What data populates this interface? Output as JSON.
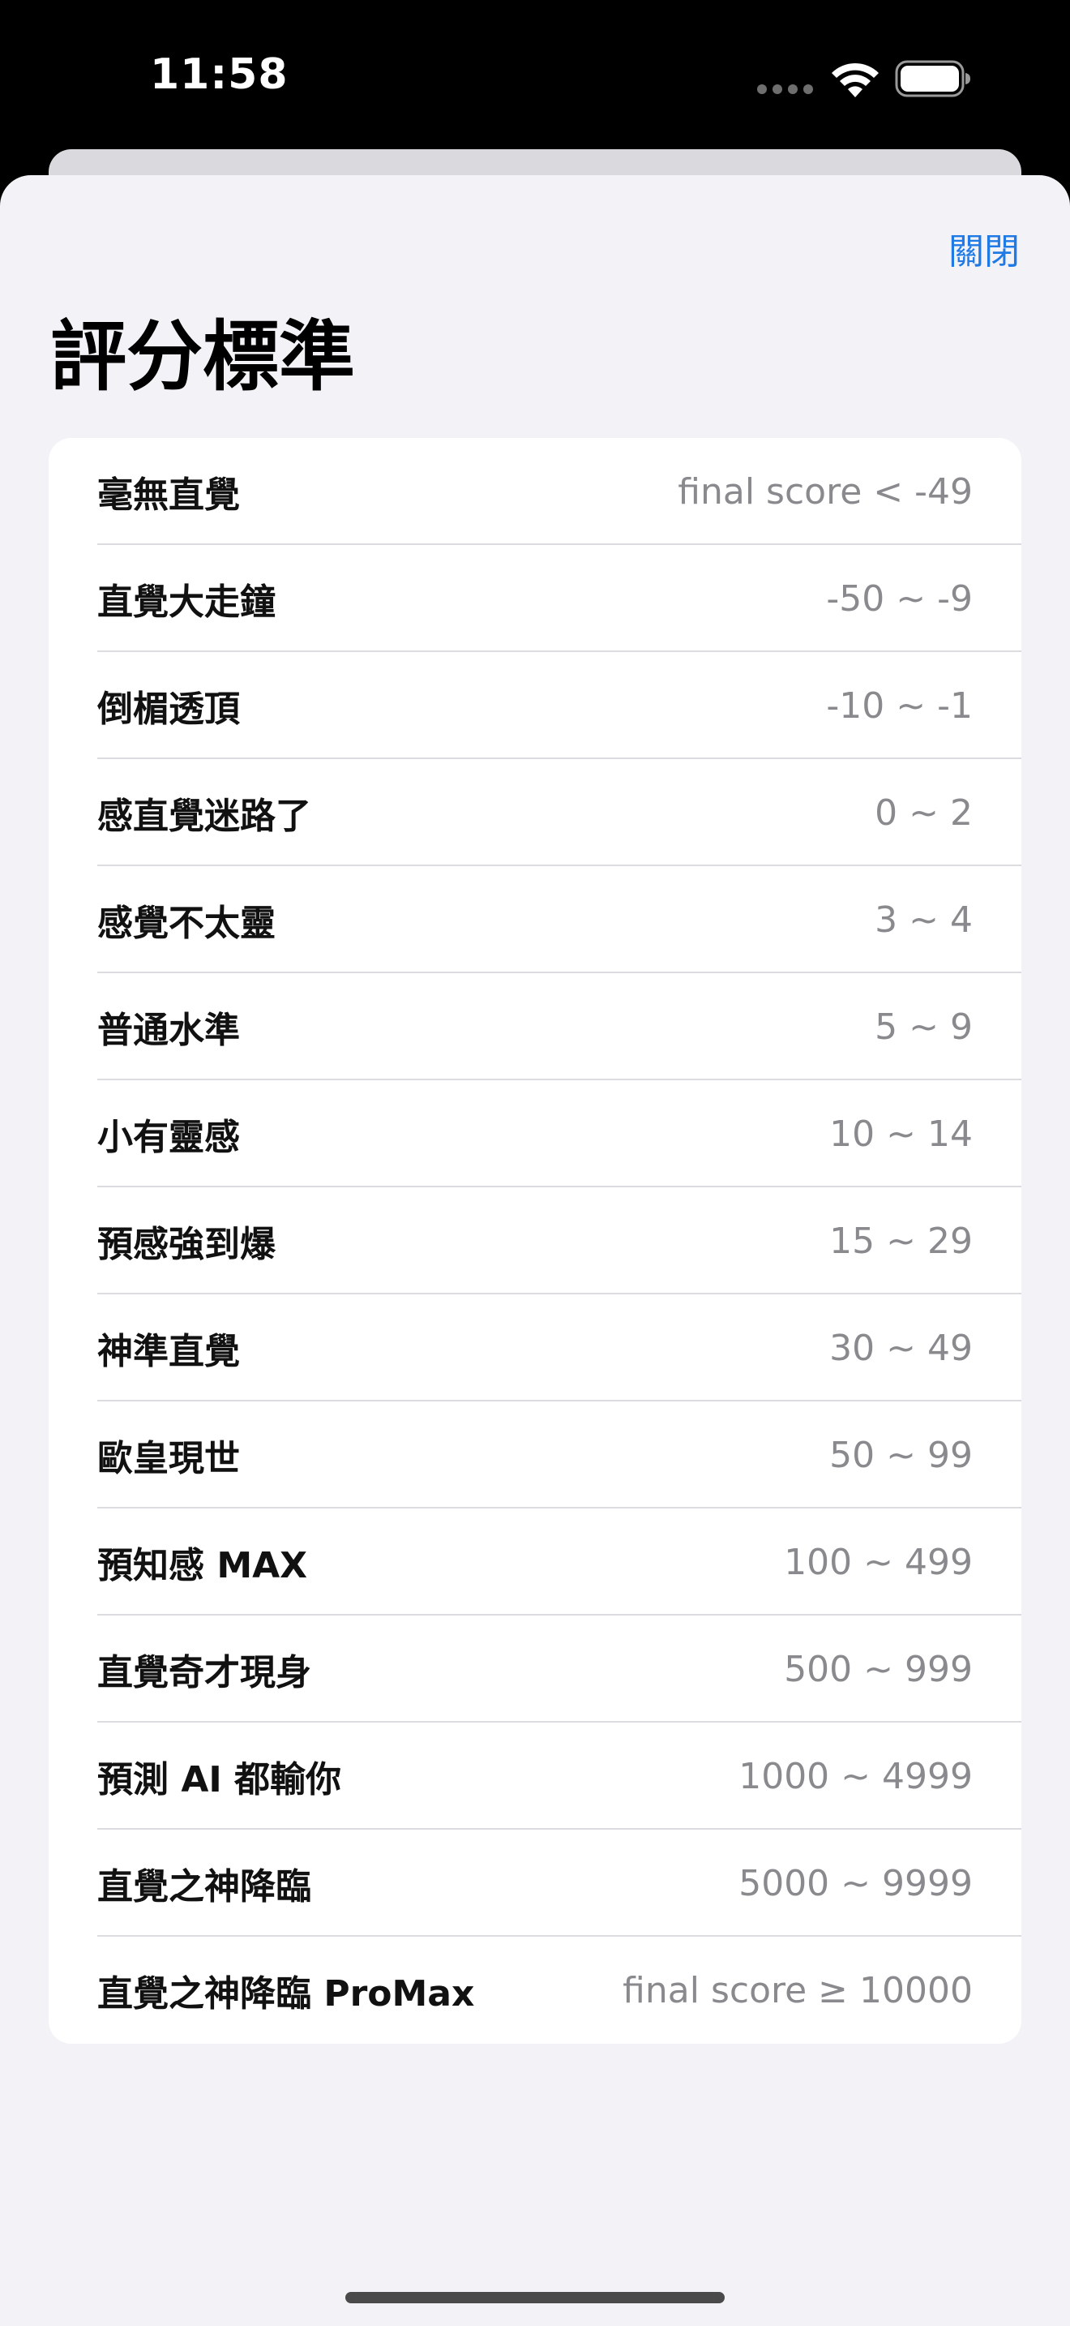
{
  "status_bar": {
    "time": "11:58"
  },
  "sheet": {
    "close_label": "關閉",
    "title": "評分標準"
  },
  "score_ranges": [
    {
      "label": "毫無直覺",
      "value": "final score < -49"
    },
    {
      "label": "直覺大走鐘",
      "value": "-50 ~ -9"
    },
    {
      "label": "倒楣透頂",
      "value": "-10 ~ -1"
    },
    {
      "label": "感直覺迷路了",
      "value": "0 ~ 2"
    },
    {
      "label": "感覺不太靈",
      "value": "3 ~ 4"
    },
    {
      "label": "普通水準",
      "value": "5 ~ 9"
    },
    {
      "label": "小有靈感",
      "value": "10 ~ 14"
    },
    {
      "label": "預感強到爆",
      "value": "15 ~ 29"
    },
    {
      "label": "神準直覺",
      "value": "30 ~ 49"
    },
    {
      "label": "歐皇現世",
      "value": "50 ~ 99"
    },
    {
      "label": "預知感 MAX",
      "value": "100 ~ 499"
    },
    {
      "label": "直覺奇才現身",
      "value": "500 ~ 999"
    },
    {
      "label": "預測 AI 都輸你",
      "value": "1000 ~ 4999"
    },
    {
      "label": "直覺之神降臨",
      "value": "5000 ~ 9999"
    },
    {
      "label": "直覺之神降臨 ProMax",
      "value": "final score ≥ 10000"
    }
  ],
  "colors": {
    "accent": "#1f7ae6",
    "sheet_background": "#f2f2f7",
    "secondary_text": "#8a8a8e"
  }
}
